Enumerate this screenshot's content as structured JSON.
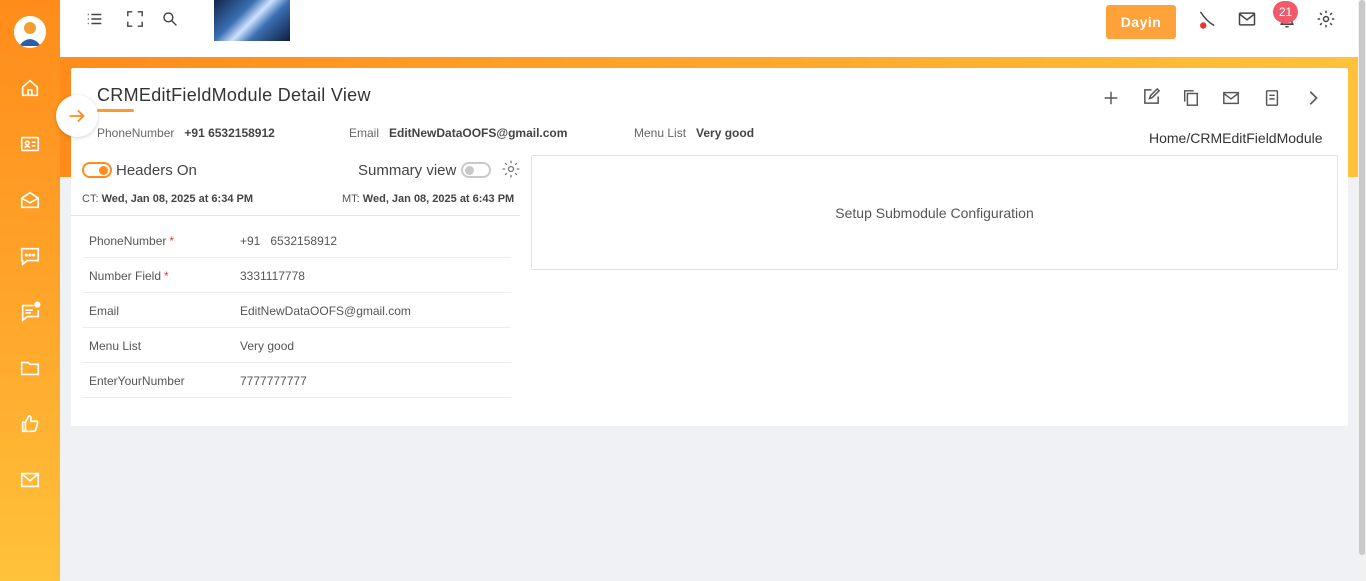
{
  "topbar": {
    "user_button": "Dayin",
    "notification_count": "21"
  },
  "page": {
    "title": "CRMEditFieldModule Detail View",
    "breadcrumb": "Home/CRMEditFieldModule"
  },
  "header_fields": [
    {
      "label": "PhoneNumber",
      "value": "+91 6532158912"
    },
    {
      "label": "Email",
      "value": "EditNewDataOOFS@gmail.com"
    },
    {
      "label": "Menu List",
      "value": "Very good"
    }
  ],
  "toggles": {
    "headers_label": "Headers On",
    "summary_label": "Summary view"
  },
  "meta": {
    "created_prefix": "CT:",
    "created_value": "Wed, Jan 08, 2025 at 6:34 PM",
    "modified_prefix": "MT:",
    "modified_value": "Wed, Jan 08, 2025 at 6:43 PM"
  },
  "fields": [
    {
      "label": "PhoneNumber",
      "required": true,
      "value": "+91   6532158912"
    },
    {
      "label": "Number Field",
      "required": true,
      "value": "3331117778"
    },
    {
      "label": "Email",
      "required": false,
      "value": "EditNewDataOOFS@gmail.com"
    },
    {
      "label": "Menu List",
      "required": false,
      "value": "Very good"
    },
    {
      "label": "EnterYourNumber",
      "required": false,
      "value": "7777777777"
    }
  ],
  "submodule": {
    "text": "Setup Submodule Configuration"
  },
  "sidebar_icons": [
    "home-icon",
    "contact-card-icon",
    "mail-open-icon",
    "chat-icon",
    "message-notification-icon",
    "folder-icon",
    "thumbs-up-icon",
    "mail-icon"
  ],
  "colors": {
    "accent": "#ff8c1a",
    "button": "#ffa23a",
    "badge": "#f05a6a"
  }
}
